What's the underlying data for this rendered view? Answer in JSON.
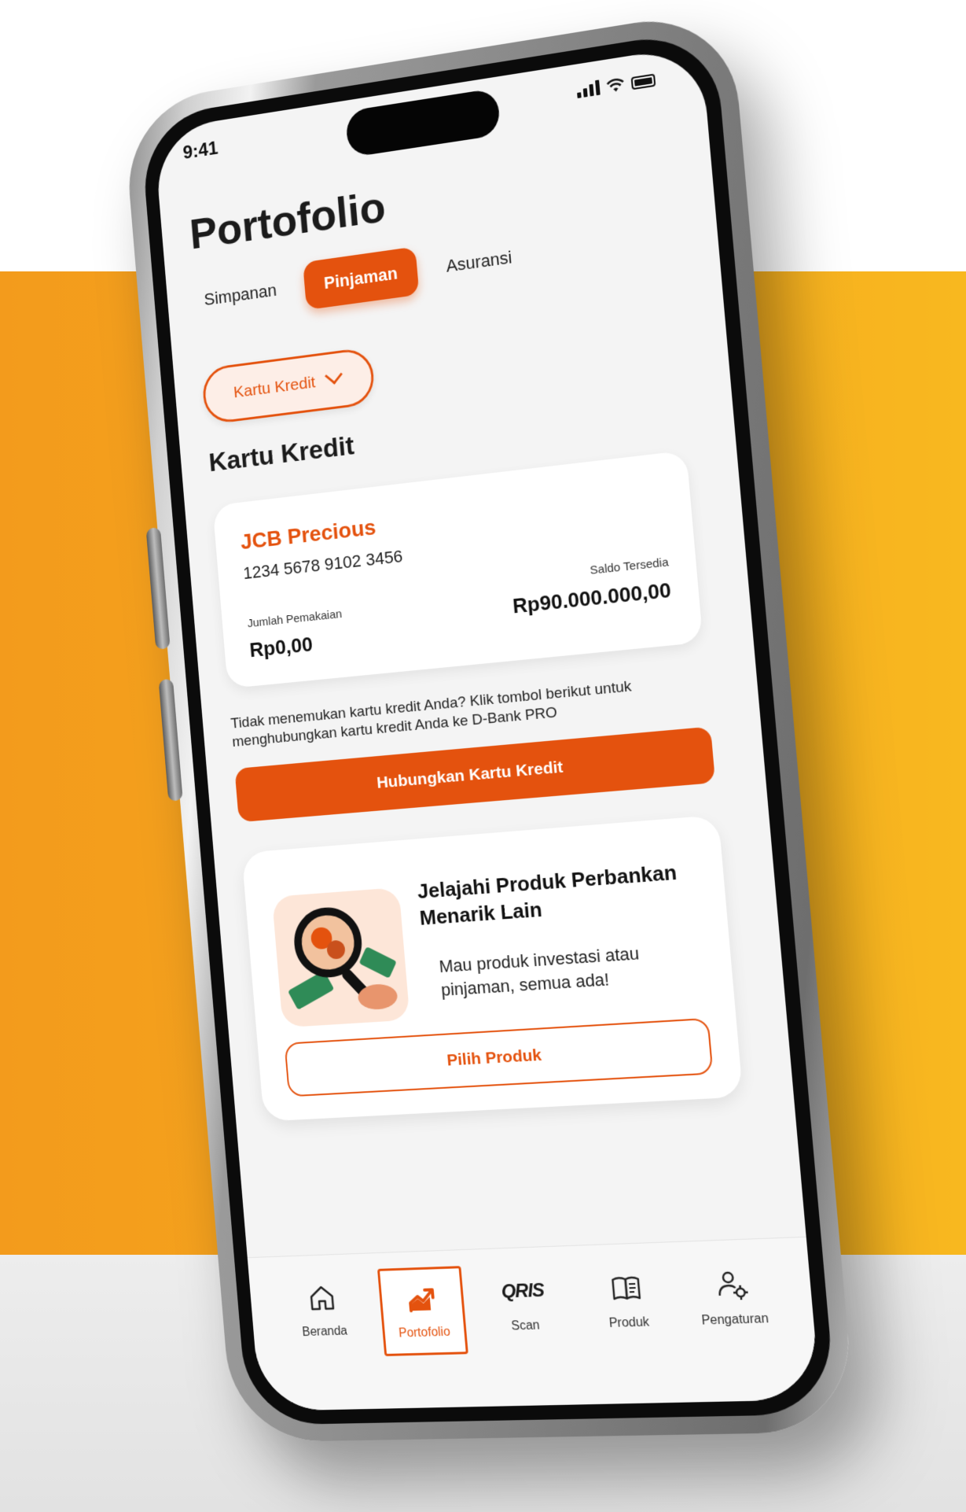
{
  "status_bar": {
    "time": "9:41"
  },
  "page_title": "Portofolio",
  "tabs": [
    {
      "label": "Simpanan",
      "active": false
    },
    {
      "label": "Pinjaman",
      "active": true
    },
    {
      "label": "Asuransi",
      "active": false
    }
  ],
  "filter": {
    "selected": "Kartu Kredit"
  },
  "section_title": "Kartu Kredit",
  "card": {
    "name": "JCB Precious",
    "number": "1234 5678 9102 3456",
    "usage_label": "Jumlah Pemakaian",
    "usage_value": "Rp0,00",
    "balance_label": "Saldo Tersedia",
    "balance_value": "Rp90.000.000,00"
  },
  "helper_text": "Tidak menemukan kartu kredit Anda? Klik tombol berikut untuk menghubungkan kartu kredit Anda ke D-Bank PRO",
  "connect_button": "Hubungkan Kartu Kredit",
  "promo": {
    "title": "Jelajahi Produk Perbankan Menarik Lain",
    "subtitle": "Mau produk investasi atau pinjaman, semua ada!",
    "button": "Pilih Produk"
  },
  "bottom_nav": [
    {
      "label": "Beranda",
      "icon": "home-icon",
      "active": false
    },
    {
      "label": "Portofolio",
      "icon": "trend-up-icon",
      "active": true
    },
    {
      "label": "Scan",
      "icon": "qris-icon",
      "active": false
    },
    {
      "label": "Produk",
      "icon": "book-icon",
      "active": false
    },
    {
      "label": "Pengaturan",
      "icon": "user-settings-icon",
      "active": false
    }
  ],
  "qris_logo_text": "QRIS",
  "colors": {
    "accent": "#e4520e",
    "background_band": "#f6aa1e",
    "screen_bg": "#f4f4f4"
  }
}
